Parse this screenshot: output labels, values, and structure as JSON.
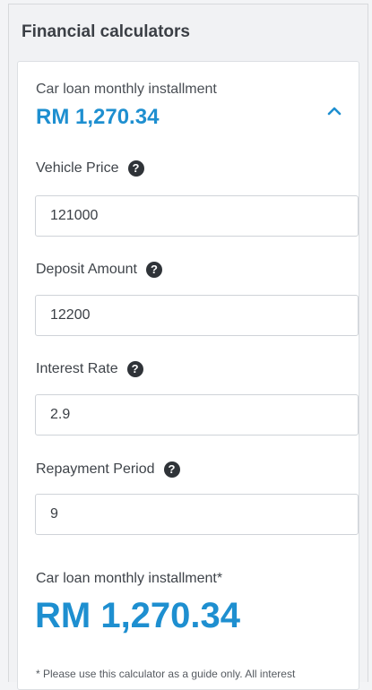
{
  "header": {
    "title": "Financial calculators"
  },
  "calculator": {
    "summary_label": "Car loan monthly installment",
    "summary_amount": "RM 1,270.34",
    "fields": [
      {
        "label": "Vehicle Price",
        "value": "121000"
      },
      {
        "label": "Deposit Amount",
        "value": "12200"
      },
      {
        "label": "Interest Rate",
        "value": "2.9"
      },
      {
        "label": "Repayment Period",
        "value": "9"
      }
    ],
    "result_label": "Car loan monthly installment*",
    "result_amount": "RM 1,270.34",
    "disclaimer": "* Please use this calculator as a guide only. All interest"
  },
  "icons": {
    "help": "help-circle-icon",
    "collapse": "chevron-up-icon"
  },
  "colors": {
    "accent": "#1e8fd0",
    "help_icon": "#2f3338"
  }
}
